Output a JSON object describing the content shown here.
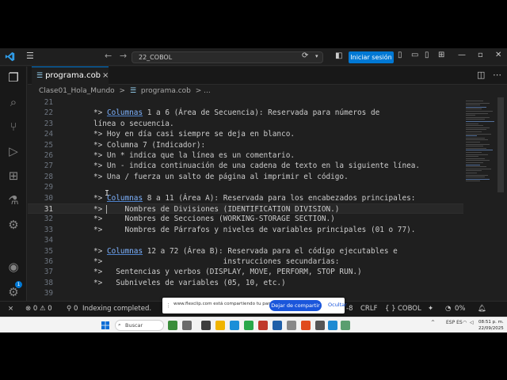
{
  "titlebar": {
    "search_text": "22_COBOL",
    "signin_label": "Iniciar sesión",
    "menu_icon": "hamburger-icon",
    "back_icon": "arrow-left-icon",
    "forward_icon": "arrow-right-icon"
  },
  "tab": {
    "label": "programa.cob",
    "close": "×"
  },
  "breadcrumb": {
    "folder": "Clase01_Hola_Mundo",
    "separator": ">",
    "file": "programa.cob",
    "tail": "> ..."
  },
  "editor": {
    "current_line": 31,
    "lines": [
      {
        "n": "21",
        "pre": "",
        "hl": "",
        "post": ""
      },
      {
        "n": "22",
        "pre": "*> ",
        "hl": "Columnas",
        "post": " 1 a 6 (Área de Secuencia): Reservada para números de"
      },
      {
        "n": "23",
        "pre": "línea o secuencia.",
        "hl": "",
        "post": ""
      },
      {
        "n": "24",
        "pre": "*> Hoy en día casi siempre se deja en blanco.",
        "hl": "",
        "post": ""
      },
      {
        "n": "25",
        "pre": "*> Columna 7 (Indicador):",
        "hl": "",
        "post": ""
      },
      {
        "n": "26",
        "pre": "*> Un * indica que la línea es un comentario.",
        "hl": "",
        "post": ""
      },
      {
        "n": "27",
        "pre": "*> Un - indica continuación de una cadena de texto en la siguiente línea.",
        "hl": "",
        "post": ""
      },
      {
        "n": "28",
        "pre": "*> Una / fuerza un salto de página al imprimir el código.",
        "hl": "",
        "post": ""
      },
      {
        "n": "29",
        "pre": "",
        "hl": "",
        "post": ""
      },
      {
        "n": "30",
        "pre": "*> ",
        "hl": "Columnas",
        "post": " 8 a 11 (Área A): Reservada para los encabezados principales:"
      },
      {
        "n": "31",
        "pre": "*>     Nombres de Divisiones (IDENTIFICATION DIVISION.)",
        "hl": "",
        "post": ""
      },
      {
        "n": "32",
        "pre": "*>     Nombres de Secciones (WORKING-STORAGE SECTION.)",
        "hl": "",
        "post": ""
      },
      {
        "n": "33",
        "pre": "*>     Nombres de Párrafos y niveles de variables principales (01 o 77).",
        "hl": "",
        "post": ""
      },
      {
        "n": "34",
        "pre": "",
        "hl": "",
        "post": ""
      },
      {
        "n": "35",
        "pre": "*> ",
        "hl": "Columnas",
        "post": " 12 a 72 (Área B): Reservada para el código ejecutables e"
      },
      {
        "n": "36",
        "pre": "*>                           instrucciones secundarias:",
        "hl": "",
        "post": ""
      },
      {
        "n": "37",
        "pre": "*>   Sentencias y verbos (DISPLAY, MOVE, PERFORM, STOP RUN.)",
        "hl": "",
        "post": ""
      },
      {
        "n": "38",
        "pre": "*>   Subniveles de variables (05, 10, etc.)",
        "hl": "",
        "post": ""
      },
      {
        "n": "39",
        "pre": "",
        "hl": "",
        "post": ""
      }
    ]
  },
  "statusbar": {
    "remote": "⨯",
    "errors": "0",
    "warnings": "0",
    "ports": "0",
    "indexing": "Indexing completed.",
    "encoding_tail": "-8",
    "eol": "CRLF",
    "language": "COBOL",
    "braces": "{ }",
    "zoom": "0%"
  },
  "share_banner": {
    "text": "www.flexclip.com está compartiendo tu pantalla.",
    "stop_label": "Dejar de compartir",
    "hide_label": "Ocultar"
  },
  "taskbar": {
    "search_placeholder": "Buscar",
    "lang": "ESP ES",
    "time": "08:51 p. m.",
    "date": "22/09/2025"
  },
  "colors": {
    "accent": "#0078d4",
    "editor_bg": "#1f1f1f",
    "keyword_highlight": "#7fb3ff"
  }
}
